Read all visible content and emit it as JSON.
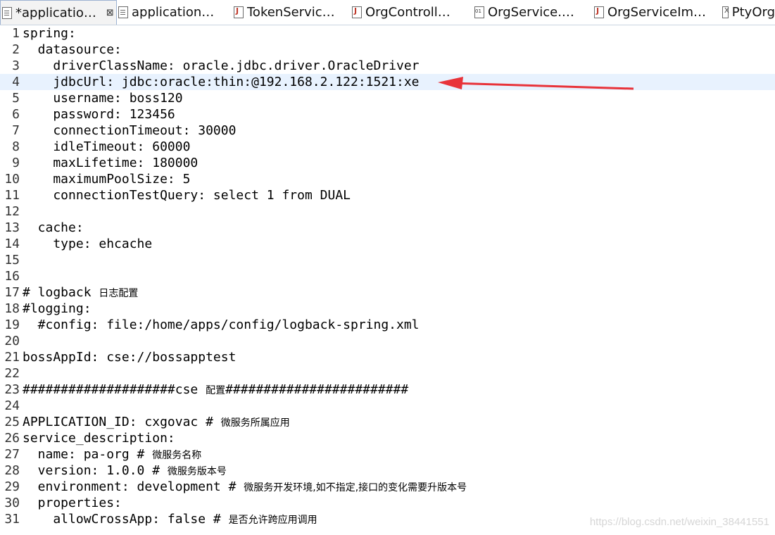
{
  "tabs": [
    {
      "label": "*applicatio…",
      "icon": "yaml-file-icon",
      "active": true
    },
    {
      "label": "application…",
      "icon": "file-icon",
      "active": false
    },
    {
      "label": "TokenServic…",
      "icon": "java-file-icon",
      "active": false
    },
    {
      "label": "OrgControll…",
      "icon": "java-file-icon",
      "active": false
    },
    {
      "label": "OrgService.…",
      "icon": "class-file-icon",
      "active": false
    },
    {
      "label": "OrgServiceIm…",
      "icon": "java-file-icon",
      "active": false
    },
    {
      "label": "PtyOrg",
      "icon": "xml-file-icon",
      "active": false
    }
  ],
  "close_glyph": "⊠",
  "lines": [
    {
      "n": "1",
      "text": "spring:"
    },
    {
      "n": "2",
      "text": "  datasource:"
    },
    {
      "n": "3",
      "text": "    driverClassName: oracle.jdbc.driver.OracleDriver"
    },
    {
      "n": "4",
      "text": "    jdbcUrl: jdbc:oracle:thin:@192.168.2.122:1521:xe"
    },
    {
      "n": "5",
      "text": "    username: boss120"
    },
    {
      "n": "6",
      "text": "    password: 123456"
    },
    {
      "n": "7",
      "text": "    connectionTimeout: 30000"
    },
    {
      "n": "8",
      "text": "    idleTimeout: 60000"
    },
    {
      "n": "9",
      "text": "    maxLifetime: 180000"
    },
    {
      "n": "10",
      "text": "    maximumPoolSize: 5"
    },
    {
      "n": "11",
      "text": "    connectionTestQuery: select 1 from DUAL"
    },
    {
      "n": "12",
      "text": ""
    },
    {
      "n": "13",
      "text": "  cache:"
    },
    {
      "n": "14",
      "text": "    type: ehcache"
    },
    {
      "n": "15",
      "text": ""
    },
    {
      "n": "16",
      "text": ""
    },
    {
      "n": "17",
      "text": "# logback ",
      "cjk": "日志配置"
    },
    {
      "n": "18",
      "text": "#logging:"
    },
    {
      "n": "19",
      "text": "  #config: file:/home/apps/config/logback-spring.xml"
    },
    {
      "n": "20",
      "text": ""
    },
    {
      "n": "21",
      "text": "bossAppId: cse://bossapptest"
    },
    {
      "n": "22",
      "text": ""
    },
    {
      "n": "23",
      "text": "####################cse ",
      "cjk": "配置",
      "text2": "########################"
    },
    {
      "n": "24",
      "text": ""
    },
    {
      "n": "25",
      "text": "APPLICATION_ID: cxgovac # ",
      "cjk": "微服务所属应用"
    },
    {
      "n": "26",
      "text": "service_description:"
    },
    {
      "n": "27",
      "text": "  name: pa-org # ",
      "cjk": "微服务名称"
    },
    {
      "n": "28",
      "text": "  version: 1.0.0 # ",
      "cjk": "微服务版本号"
    },
    {
      "n": "29",
      "text": "  environment: development # ",
      "cjk": "微服务开发环境,如不指定,接口的变化需要升版本号"
    },
    {
      "n": "30",
      "text": "  properties:"
    },
    {
      "n": "31",
      "text": "    allowCrossApp: false # ",
      "cjk": "是否允许跨应用调用"
    }
  ],
  "current_line": "4",
  "annotation_color": "#e8333a",
  "watermark": "https://blog.csdn.net/weixin_38441551"
}
